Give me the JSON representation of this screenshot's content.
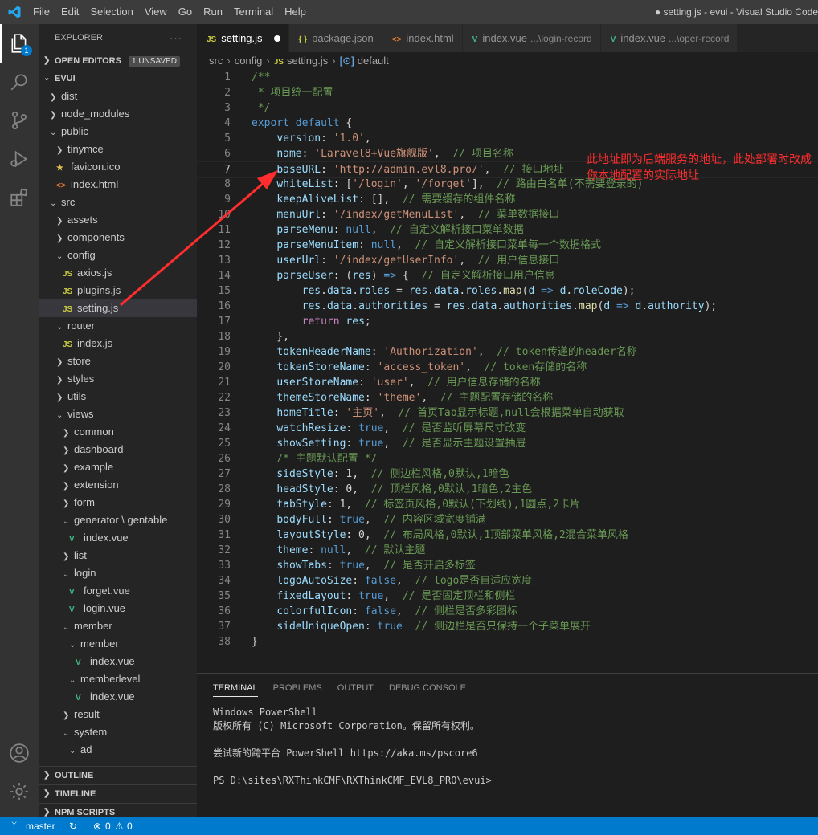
{
  "titlebar": {
    "menu": [
      "File",
      "Edit",
      "Selection",
      "View",
      "Go",
      "Run",
      "Terminal",
      "Help"
    ],
    "title": "● setting.js - evui - Visual Studio Code"
  },
  "activity": {
    "explorer_badge": "1"
  },
  "sidebar": {
    "header": "EXPLORER",
    "more": "···",
    "open_editors": "OPEN EDITORS",
    "unsaved": "1 UNSAVED",
    "root": "EVUI",
    "tree": [
      {
        "label": "dist",
        "depth": 1,
        "kind": "folder",
        "open": false
      },
      {
        "label": "node_modules",
        "depth": 1,
        "kind": "folder",
        "open": false
      },
      {
        "label": "public",
        "depth": 1,
        "kind": "folder",
        "open": true
      },
      {
        "label": "tinymce",
        "depth": 2,
        "kind": "folder",
        "open": false
      },
      {
        "label": "favicon.ico",
        "depth": 2,
        "kind": "star"
      },
      {
        "label": "index.html",
        "depth": 2,
        "kind": "html"
      },
      {
        "label": "src",
        "depth": 1,
        "kind": "folder",
        "open": true
      },
      {
        "label": "assets",
        "depth": 2,
        "kind": "folder",
        "open": false
      },
      {
        "label": "components",
        "depth": 2,
        "kind": "folder",
        "open": false
      },
      {
        "label": "config",
        "depth": 2,
        "kind": "folder",
        "open": true
      },
      {
        "label": "axios.js",
        "depth": 3,
        "kind": "js"
      },
      {
        "label": "plugins.js",
        "depth": 3,
        "kind": "js"
      },
      {
        "label": "setting.js",
        "depth": 3,
        "kind": "js",
        "selected": true
      },
      {
        "label": "router",
        "depth": 2,
        "kind": "folder",
        "open": true
      },
      {
        "label": "index.js",
        "depth": 3,
        "kind": "js"
      },
      {
        "label": "store",
        "depth": 2,
        "kind": "folder",
        "open": false
      },
      {
        "label": "styles",
        "depth": 2,
        "kind": "folder",
        "open": false
      },
      {
        "label": "utils",
        "depth": 2,
        "kind": "folder",
        "open": false
      },
      {
        "label": "views",
        "depth": 2,
        "kind": "folder",
        "open": true
      },
      {
        "label": "common",
        "depth": 3,
        "kind": "folder",
        "open": false
      },
      {
        "label": "dashboard",
        "depth": 3,
        "kind": "folder",
        "open": false
      },
      {
        "label": "example",
        "depth": 3,
        "kind": "folder",
        "open": false
      },
      {
        "label": "extension",
        "depth": 3,
        "kind": "folder",
        "open": false
      },
      {
        "label": "form",
        "depth": 3,
        "kind": "folder",
        "open": false
      },
      {
        "label": "generator \\ gentable",
        "depth": 3,
        "kind": "folder",
        "open": true
      },
      {
        "label": "index.vue",
        "depth": 4,
        "kind": "vue"
      },
      {
        "label": "list",
        "depth": 3,
        "kind": "folder",
        "open": false
      },
      {
        "label": "login",
        "depth": 3,
        "kind": "folder",
        "open": true
      },
      {
        "label": "forget.vue",
        "depth": 4,
        "kind": "vue"
      },
      {
        "label": "login.vue",
        "depth": 4,
        "kind": "vue"
      },
      {
        "label": "member",
        "depth": 3,
        "kind": "folder",
        "open": true
      },
      {
        "label": "member",
        "depth": 4,
        "kind": "folder",
        "open": true
      },
      {
        "label": "index.vue",
        "depth": 5,
        "kind": "vue"
      },
      {
        "label": "memberlevel",
        "depth": 4,
        "kind": "folder",
        "open": true
      },
      {
        "label": "index.vue",
        "depth": 5,
        "kind": "vue"
      },
      {
        "label": "result",
        "depth": 3,
        "kind": "folder",
        "open": false
      },
      {
        "label": "system",
        "depth": 3,
        "kind": "folder",
        "open": true
      },
      {
        "label": "ad",
        "depth": 4,
        "kind": "folder",
        "open": true
      }
    ],
    "outline": "OUTLINE",
    "timeline": "TIMELINE",
    "npm_scripts": "NPM SCRIPTS"
  },
  "tabs": [
    {
      "icon": "JS",
      "label": "setting.js",
      "kind": "js",
      "active": true,
      "dirty": true,
      "desc": ""
    },
    {
      "icon": "{ }",
      "label": "package.json",
      "kind": "json",
      "active": false,
      "dirty": false,
      "desc": ""
    },
    {
      "icon": "<>",
      "label": "index.html",
      "kind": "html",
      "active": false,
      "dirty": false,
      "desc": ""
    },
    {
      "icon": "V",
      "label": "index.vue",
      "kind": "vue",
      "active": false,
      "dirty": false,
      "desc": "...\\login-record"
    },
    {
      "icon": "V",
      "label": "index.vue",
      "kind": "vue",
      "active": false,
      "dirty": false,
      "desc": "...\\oper-record"
    }
  ],
  "breadcrumb": {
    "parts": [
      "src",
      "config"
    ],
    "file_icon": "JS",
    "file": "setting.js",
    "symbol": "default"
  },
  "code": {
    "current_line": 7,
    "lines": [
      [
        [
          "c",
          "/**"
        ]
      ],
      [
        [
          "c",
          " * 项目统一配置"
        ]
      ],
      [
        [
          "c",
          " */"
        ]
      ],
      [
        [
          "k",
          "export"
        ],
        [
          "d",
          " "
        ],
        [
          "k",
          "default"
        ],
        [
          "d",
          " {"
        ]
      ],
      [
        [
          "d",
          "    "
        ],
        [
          "p",
          "version"
        ],
        [
          "d",
          ": "
        ],
        [
          "s",
          "'1.0'"
        ],
        [
          "d",
          ","
        ]
      ],
      [
        [
          "d",
          "    "
        ],
        [
          "p",
          "name"
        ],
        [
          "d",
          ": "
        ],
        [
          "s",
          "'Laravel8+Vue旗舰版'"
        ],
        [
          "d",
          ",  "
        ],
        [
          "c",
          "// 项目名称"
        ]
      ],
      [
        [
          "d",
          "    "
        ],
        [
          "p",
          "baseURL"
        ],
        [
          "d",
          ": "
        ],
        [
          "s",
          "'http://admin.evl8.pro/'"
        ],
        [
          "d",
          ",  "
        ],
        [
          "c",
          "// 接口地址"
        ]
      ],
      [
        [
          "d",
          "    "
        ],
        [
          "p",
          "whiteList"
        ],
        [
          "d",
          ": ["
        ],
        [
          "s",
          "'/login'"
        ],
        [
          "d",
          ", "
        ],
        [
          "s",
          "'/forget'"
        ],
        [
          "d",
          "],  "
        ],
        [
          "c",
          "// 路由白名单(不需要登录的)"
        ]
      ],
      [
        [
          "d",
          "    "
        ],
        [
          "p",
          "keepAliveList"
        ],
        [
          "d",
          ": [],  "
        ],
        [
          "c",
          "// 需要缓存的组件名称"
        ]
      ],
      [
        [
          "d",
          "    "
        ],
        [
          "p",
          "menuUrl"
        ],
        [
          "d",
          ": "
        ],
        [
          "s",
          "'/index/getMenuList'"
        ],
        [
          "d",
          ",  "
        ],
        [
          "c",
          "// 菜单数据接口"
        ]
      ],
      [
        [
          "d",
          "    "
        ],
        [
          "p",
          "parseMenu"
        ],
        [
          "d",
          ": "
        ],
        [
          "k",
          "null"
        ],
        [
          "d",
          ",  "
        ],
        [
          "c",
          "// 自定义解析接口菜单数据"
        ]
      ],
      [
        [
          "d",
          "    "
        ],
        [
          "p",
          "parseMenuItem"
        ],
        [
          "d",
          ": "
        ],
        [
          "k",
          "null"
        ],
        [
          "d",
          ",  "
        ],
        [
          "c",
          "// 自定义解析接口菜单每一个数据格式"
        ]
      ],
      [
        [
          "d",
          "    "
        ],
        [
          "p",
          "userUrl"
        ],
        [
          "d",
          ": "
        ],
        [
          "s",
          "'/index/getUserInfo'"
        ],
        [
          "d",
          ",  "
        ],
        [
          "c",
          "// 用户信息接口"
        ]
      ],
      [
        [
          "d",
          "    "
        ],
        [
          "p",
          "parseUser"
        ],
        [
          "d",
          ": ("
        ],
        [
          "v",
          "res"
        ],
        [
          "d",
          ") "
        ],
        [
          "k",
          "=>"
        ],
        [
          "d",
          " {  "
        ],
        [
          "c",
          "// 自定义解析接口用户信息"
        ]
      ],
      [
        [
          "d",
          "        "
        ],
        [
          "v",
          "res"
        ],
        [
          "d",
          "."
        ],
        [
          "v",
          "data"
        ],
        [
          "d",
          "."
        ],
        [
          "v",
          "roles"
        ],
        [
          "d",
          " = "
        ],
        [
          "v",
          "res"
        ],
        [
          "d",
          "."
        ],
        [
          "v",
          "data"
        ],
        [
          "d",
          "."
        ],
        [
          "v",
          "roles"
        ],
        [
          "d",
          "."
        ],
        [
          "f",
          "map"
        ],
        [
          "d",
          "("
        ],
        [
          "v",
          "d"
        ],
        [
          "d",
          " "
        ],
        [
          "k",
          "=>"
        ],
        [
          "d",
          " "
        ],
        [
          "v",
          "d"
        ],
        [
          "d",
          "."
        ],
        [
          "v",
          "roleCode"
        ],
        [
          "d",
          ");"
        ]
      ],
      [
        [
          "d",
          "        "
        ],
        [
          "v",
          "res"
        ],
        [
          "d",
          "."
        ],
        [
          "v",
          "data"
        ],
        [
          "d",
          "."
        ],
        [
          "v",
          "authorities"
        ],
        [
          "d",
          " = "
        ],
        [
          "v",
          "res"
        ],
        [
          "d",
          "."
        ],
        [
          "v",
          "data"
        ],
        [
          "d",
          "."
        ],
        [
          "v",
          "authorities"
        ],
        [
          "d",
          "."
        ],
        [
          "f",
          "map"
        ],
        [
          "d",
          "("
        ],
        [
          "v",
          "d"
        ],
        [
          "d",
          " "
        ],
        [
          "k",
          "=>"
        ],
        [
          "d",
          " "
        ],
        [
          "v",
          "d"
        ],
        [
          "d",
          "."
        ],
        [
          "v",
          "authority"
        ],
        [
          "d",
          ");"
        ]
      ],
      [
        [
          "d",
          "        "
        ],
        [
          "kw",
          "return"
        ],
        [
          "d",
          " "
        ],
        [
          "v",
          "res"
        ],
        [
          "d",
          ";"
        ]
      ],
      [
        [
          "d",
          "    },"
        ]
      ],
      [
        [
          "d",
          "    "
        ],
        [
          "p",
          "tokenHeaderName"
        ],
        [
          "d",
          ": "
        ],
        [
          "s",
          "'Authorization'"
        ],
        [
          "d",
          ",  "
        ],
        [
          "c",
          "// token传递的header名称"
        ]
      ],
      [
        [
          "d",
          "    "
        ],
        [
          "p",
          "tokenStoreName"
        ],
        [
          "d",
          ": "
        ],
        [
          "s",
          "'access_token'"
        ],
        [
          "d",
          ",  "
        ],
        [
          "c",
          "// token存储的名称"
        ]
      ],
      [
        [
          "d",
          "    "
        ],
        [
          "p",
          "userStoreName"
        ],
        [
          "d",
          ": "
        ],
        [
          "s",
          "'user'"
        ],
        [
          "d",
          ",  "
        ],
        [
          "c",
          "// 用户信息存储的名称"
        ]
      ],
      [
        [
          "d",
          "    "
        ],
        [
          "p",
          "themeStoreName"
        ],
        [
          "d",
          ": "
        ],
        [
          "s",
          "'theme'"
        ],
        [
          "d",
          ",  "
        ],
        [
          "c",
          "// 主题配置存储的名称"
        ]
      ],
      [
        [
          "d",
          "    "
        ],
        [
          "p",
          "homeTitle"
        ],
        [
          "d",
          ": "
        ],
        [
          "s",
          "'主页'"
        ],
        [
          "d",
          ",  "
        ],
        [
          "c",
          "// 首页Tab显示标题,null会根据菜单自动获取"
        ]
      ],
      [
        [
          "d",
          "    "
        ],
        [
          "p",
          "watchResize"
        ],
        [
          "d",
          ": "
        ],
        [
          "k",
          "true"
        ],
        [
          "d",
          ",  "
        ],
        [
          "c",
          "// 是否监听屏幕尺寸改变"
        ]
      ],
      [
        [
          "d",
          "    "
        ],
        [
          "p",
          "showSetting"
        ],
        [
          "d",
          ": "
        ],
        [
          "k",
          "true"
        ],
        [
          "d",
          ",  "
        ],
        [
          "c",
          "// 是否显示主题设置抽屉"
        ]
      ],
      [
        [
          "d",
          "    "
        ],
        [
          "c",
          "/* 主题默认配置 */"
        ]
      ],
      [
        [
          "d",
          "    "
        ],
        [
          "p",
          "sideStyle"
        ],
        [
          "d",
          ": 1,  "
        ],
        [
          "c",
          "// 侧边栏风格,0默认,1暗色"
        ]
      ],
      [
        [
          "d",
          "    "
        ],
        [
          "p",
          "headStyle"
        ],
        [
          "d",
          ": 0,  "
        ],
        [
          "c",
          "// 顶栏风格,0默认,1暗色,2主色"
        ]
      ],
      [
        [
          "d",
          "    "
        ],
        [
          "p",
          "tabStyle"
        ],
        [
          "d",
          ": 1,  "
        ],
        [
          "c",
          "// 标签页风格,0默认(下划线),1圆点,2卡片"
        ]
      ],
      [
        [
          "d",
          "    "
        ],
        [
          "p",
          "bodyFull"
        ],
        [
          "d",
          ": "
        ],
        [
          "k",
          "true"
        ],
        [
          "d",
          ",  "
        ],
        [
          "c",
          "// 内容区域宽度铺满"
        ]
      ],
      [
        [
          "d",
          "    "
        ],
        [
          "p",
          "layoutStyle"
        ],
        [
          "d",
          ": 0,  "
        ],
        [
          "c",
          "// 布局风格,0默认,1顶部菜单风格,2混合菜单风格"
        ]
      ],
      [
        [
          "d",
          "    "
        ],
        [
          "p",
          "theme"
        ],
        [
          "d",
          ": "
        ],
        [
          "k",
          "null"
        ],
        [
          "d",
          ",  "
        ],
        [
          "c",
          "// 默认主题"
        ]
      ],
      [
        [
          "d",
          "    "
        ],
        [
          "p",
          "showTabs"
        ],
        [
          "d",
          ": "
        ],
        [
          "k",
          "true"
        ],
        [
          "d",
          ",  "
        ],
        [
          "c",
          "// 是否开启多标签"
        ]
      ],
      [
        [
          "d",
          "    "
        ],
        [
          "p",
          "logoAutoSize"
        ],
        [
          "d",
          ": "
        ],
        [
          "k",
          "false"
        ],
        [
          "d",
          ",  "
        ],
        [
          "c",
          "// logo是否自适应宽度"
        ]
      ],
      [
        [
          "d",
          "    "
        ],
        [
          "p",
          "fixedLayout"
        ],
        [
          "d",
          ": "
        ],
        [
          "k",
          "true"
        ],
        [
          "d",
          ",  "
        ],
        [
          "c",
          "// 是否固定顶栏和侧栏"
        ]
      ],
      [
        [
          "d",
          "    "
        ],
        [
          "p",
          "colorfulIcon"
        ],
        [
          "d",
          ": "
        ],
        [
          "k",
          "false"
        ],
        [
          "d",
          ",  "
        ],
        [
          "c",
          "// 侧栏是否多彩图标"
        ]
      ],
      [
        [
          "d",
          "    "
        ],
        [
          "p",
          "sideUniqueOpen"
        ],
        [
          "d",
          ": "
        ],
        [
          "k",
          "true"
        ],
        [
          "d",
          "  "
        ],
        [
          "c",
          "// 侧边栏是否只保持一个子菜单展开"
        ]
      ],
      [
        [
          "d",
          "}"
        ]
      ]
    ]
  },
  "annotation": "此地址即为后端服务的地址，此处部署时改成你本地配置的实际地址",
  "panel": {
    "tabs": [
      "TERMINAL",
      "PROBLEMS",
      "OUTPUT",
      "DEBUG CONSOLE"
    ],
    "active_tab": 0,
    "terminal_lines": [
      "Windows PowerShell",
      "版权所有 (C) Microsoft Corporation。保留所有权利。",
      "",
      "尝试新的跨平台 PowerShell https://aka.ms/pscore6",
      "",
      "PS D:\\sites\\RXThinkCMF\\RXThinkCMF_EVL8_PRO\\evui>"
    ]
  },
  "statusbar": {
    "branch": "master",
    "errors": "0",
    "warnings": "0"
  },
  "colors": {
    "accent": "#007acc",
    "annotation": "#ff2d2d"
  }
}
